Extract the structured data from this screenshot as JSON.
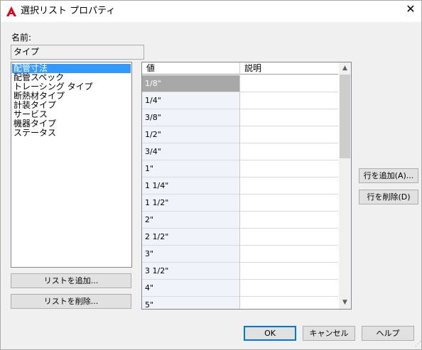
{
  "window": {
    "title": "選択リスト プロパティ",
    "app_icon": "autocad-a-icon",
    "close_glyph": "✕"
  },
  "name_section": {
    "label": "名前:",
    "value": "タイプ"
  },
  "lists": {
    "items": [
      {
        "label": "配管寸法",
        "selected": true
      },
      {
        "label": "配管スペック",
        "selected": false
      },
      {
        "label": "トレーシング タイプ",
        "selected": false
      },
      {
        "label": "断熱材タイプ",
        "selected": false
      },
      {
        "label": "計装タイプ",
        "selected": false
      },
      {
        "label": "サービス",
        "selected": false
      },
      {
        "label": "機器タイプ",
        "selected": false
      },
      {
        "label": "ステータス",
        "selected": false
      }
    ],
    "add_button": "リストを追加...",
    "delete_button": "リストを削除..."
  },
  "grid": {
    "columns": [
      "値",
      "説明"
    ],
    "rows": [
      {
        "value": "1/8\"",
        "description": "",
        "selected": true
      },
      {
        "value": "1/4\"",
        "description": ""
      },
      {
        "value": "3/8\"",
        "description": ""
      },
      {
        "value": "1/2\"",
        "description": ""
      },
      {
        "value": "3/4\"",
        "description": ""
      },
      {
        "value": "1\"",
        "description": ""
      },
      {
        "value": "1 1/4\"",
        "description": ""
      },
      {
        "value": "1 1/2\"",
        "description": ""
      },
      {
        "value": "2\"",
        "description": ""
      },
      {
        "value": "2 1/2\"",
        "description": ""
      },
      {
        "value": "3\"",
        "description": ""
      },
      {
        "value": "3 1/2\"",
        "description": ""
      },
      {
        "value": "4\"",
        "description": ""
      },
      {
        "value": "5\"",
        "description": ""
      }
    ]
  },
  "row_actions": {
    "add_row": "行を追加(A)...",
    "delete_row": "行を削除(D)"
  },
  "footer": {
    "ok": "OK",
    "cancel": "キャンセル",
    "help": "ヘルプ"
  },
  "colors": {
    "selection": "#3399ff",
    "grid_selection": "#a8a8a8",
    "focus_border": "#0078d7"
  }
}
